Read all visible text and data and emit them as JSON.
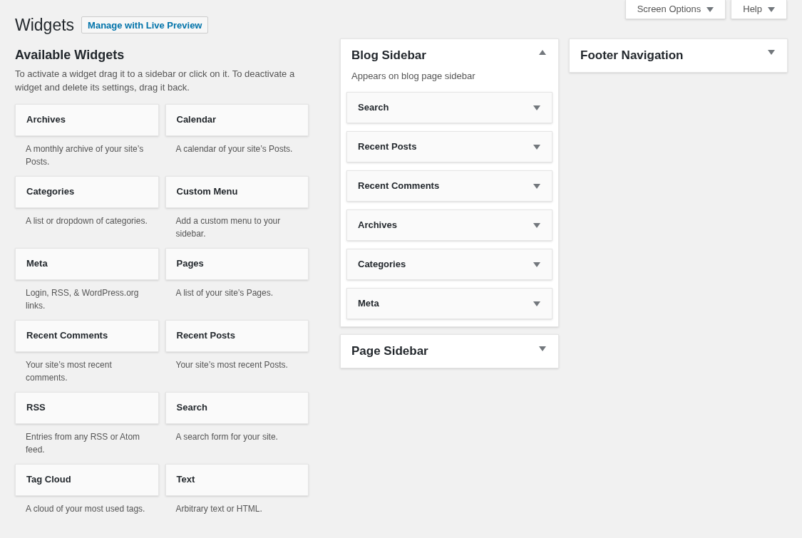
{
  "header": {
    "title": "Widgets",
    "live_preview_button": "Manage with Live Preview"
  },
  "screen_tabs": [
    {
      "label": "Screen Options"
    },
    {
      "label": "Help"
    }
  ],
  "available_widgets": {
    "title": "Available Widgets",
    "description": "To activate a widget drag it to a sidebar or click on it. To deactivate a widget and delete its settings, drag it back.",
    "widgets": [
      {
        "name": "Archives",
        "description": "A monthly archive of your site’s Posts."
      },
      {
        "name": "Calendar",
        "description": "A calendar of your site’s Posts."
      },
      {
        "name": "Categories",
        "description": "A list or dropdown of categories."
      },
      {
        "name": "Custom Menu",
        "description": "Add a custom menu to your sidebar."
      },
      {
        "name": "Meta",
        "description": "Login, RSS, & WordPress.org links."
      },
      {
        "name": "Pages",
        "description": "A list of your site’s Pages."
      },
      {
        "name": "Recent Comments",
        "description": "Your site’s most recent comments."
      },
      {
        "name": "Recent Posts",
        "description": "Your site’s most recent Posts."
      },
      {
        "name": "RSS",
        "description": "Entries from any RSS or Atom feed."
      },
      {
        "name": "Search",
        "description": "A search form for your site."
      },
      {
        "name": "Tag Cloud",
        "description": "A cloud of your most used tags."
      },
      {
        "name": "Text",
        "description": "Arbitrary text or HTML."
      }
    ]
  },
  "sidebar_columns": [
    [
      {
        "title": "Blog Sidebar",
        "expanded": true,
        "description": "Appears on blog page sidebar",
        "widgets": [
          "Search",
          "Recent Posts",
          "Recent Comments",
          "Archives",
          "Categories",
          "Meta"
        ]
      },
      {
        "title": "Page Sidebar",
        "expanded": false
      }
    ],
    [
      {
        "title": "Footer Navigation",
        "expanded": false
      }
    ]
  ]
}
